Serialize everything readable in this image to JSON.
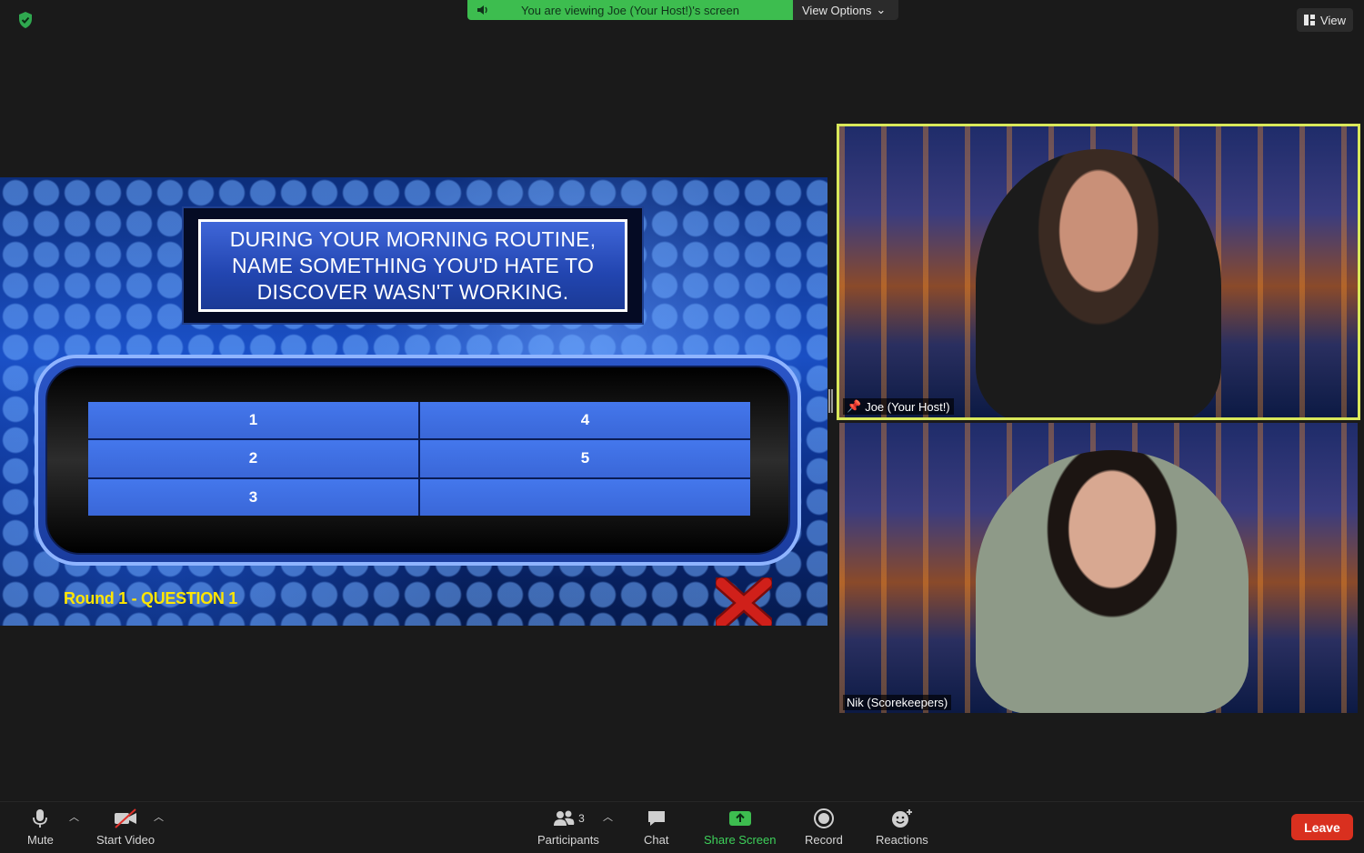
{
  "top_bar": {
    "share_message": "You are viewing Joe (Your Host!)'s screen",
    "view_options_label": "View Options",
    "view_label": "View"
  },
  "shared_screen": {
    "question": "DURING YOUR MORNING ROUTINE, NAME SOMETHING YOU'D HATE TO DISCOVER WASN'T WORKING.",
    "answers": [
      "1",
      "4",
      "2",
      "5",
      "3",
      ""
    ],
    "round_label": "Round 1 - QUESTION 1"
  },
  "participants_video": [
    {
      "name": "Joe (Your Host!)",
      "pinned": true,
      "active_speaker": true
    },
    {
      "name": "Nik (Scorekeepers)",
      "pinned": false,
      "active_speaker": false
    }
  ],
  "toolbar": {
    "mute_label": "Mute",
    "start_video_label": "Start Video",
    "participants_label": "Participants",
    "participants_count": "3",
    "chat_label": "Chat",
    "share_screen_label": "Share Screen",
    "record_label": "Record",
    "reactions_label": "Reactions",
    "leave_label": "Leave"
  },
  "colors": {
    "accent_green": "#3dbd4f",
    "leave_red": "#d9301f",
    "active_speaker_border": "#d9e85a",
    "round_label_yellow": "#ffe600"
  }
}
